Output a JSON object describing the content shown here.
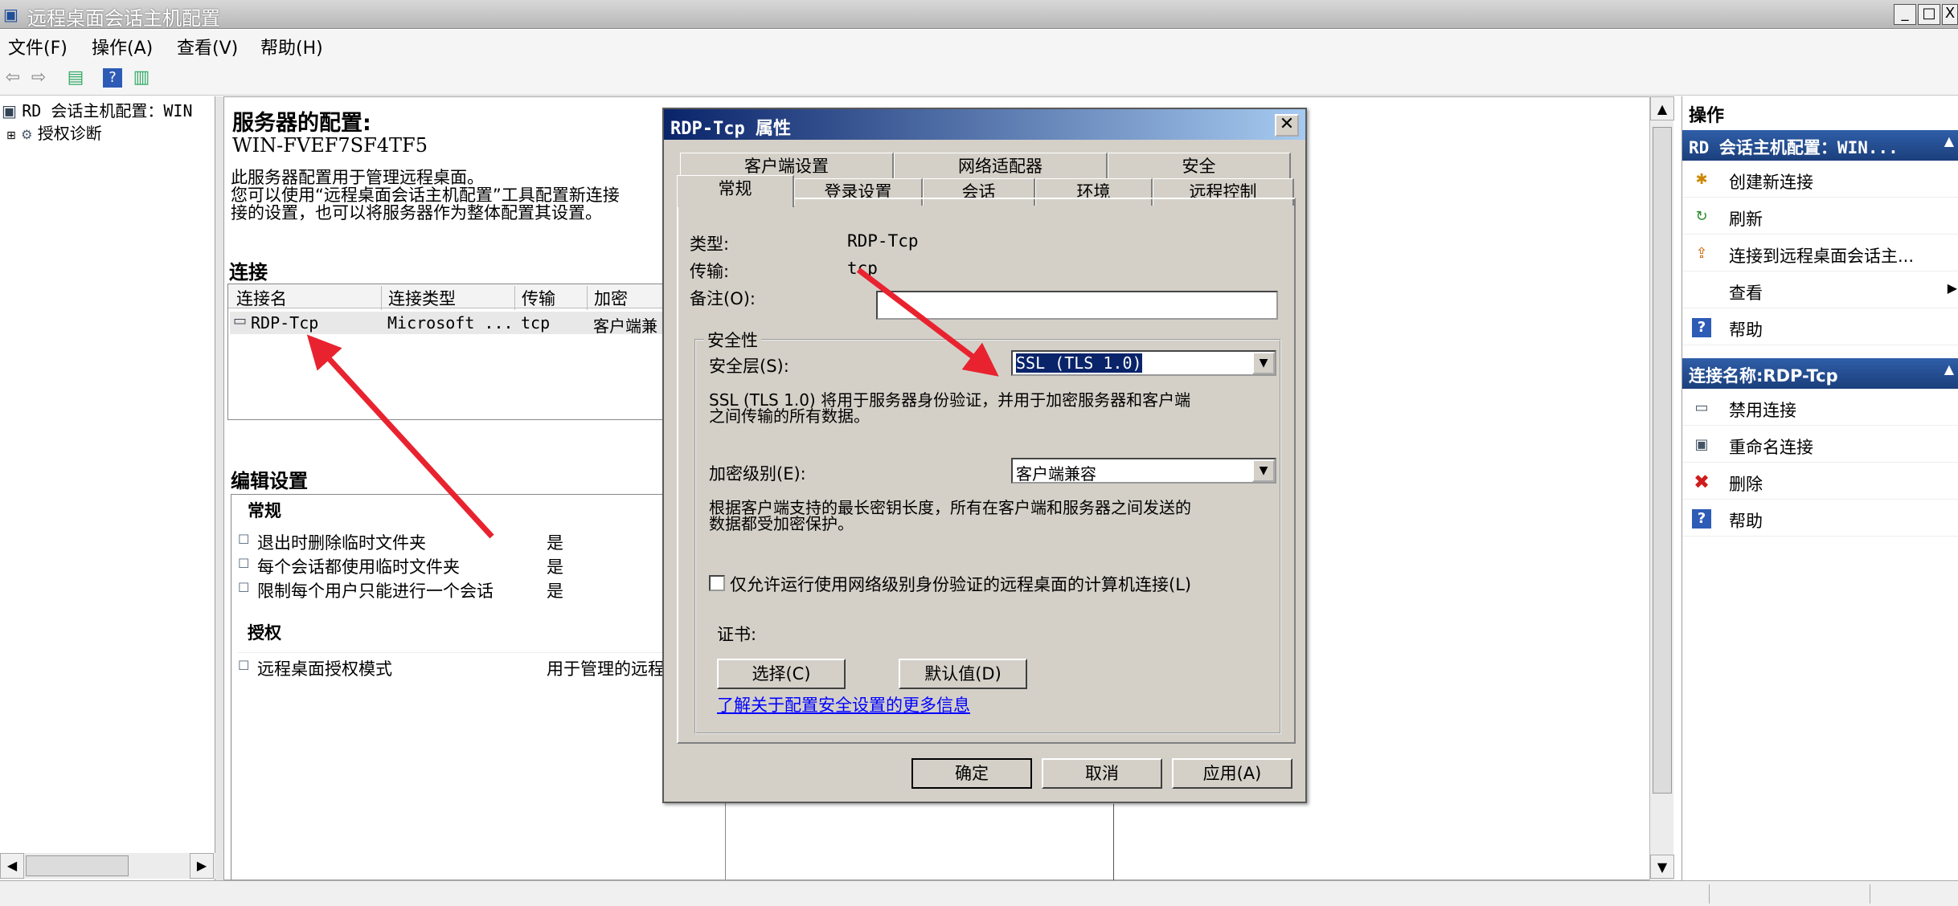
{
  "window": {
    "title": "远程桌面会话主机配置",
    "min": "_",
    "max": "□",
    "close": "X"
  },
  "menu": [
    "文件(F)",
    "操作(A)",
    "查看(V)",
    "帮助(H)"
  ],
  "tree": {
    "root": "RD 会话主机配置：WIN",
    "child": "授权诊断"
  },
  "center": {
    "heading": "服务器的配置:",
    "server": "WIN-FVEF7SF4TF5",
    "desc1": "此服务器配置用于管理远程桌面。",
    "desc2": "您可以使用“远程桌面会话主机配置”工具配置新连接",
    "desc3": "接的设置，也可以将服务器作为整体配置其设置。",
    "connections_title": "连接",
    "columns": [
      "连接名",
      "连接类型",
      "传输",
      "加密"
    ],
    "row": [
      "RDP-Tcp",
      "Microsoft ...",
      "tcp",
      "客户端兼"
    ],
    "edit_title": "编辑设置",
    "general": "常规",
    "settings": [
      {
        "name": "退出时删除临时文件夹",
        "value": "是"
      },
      {
        "name": "每个会话都使用临时文件夹",
        "value": "是"
      },
      {
        "name": "限制每个用户只能进行一个会话",
        "value": "是"
      }
    ],
    "licensing": "授权",
    "license_item": {
      "name": "远程桌面授权模式",
      "value": "用于管理的远程"
    }
  },
  "actions": {
    "header": "操作",
    "section1": "RD 会话主机配置：WIN...",
    "items1": [
      "创建新连接",
      "刷新",
      "连接到远程桌面会话主...",
      "查看",
      "帮助"
    ],
    "section2": "连接名称:RDP-Tcp",
    "items2": [
      "禁用连接",
      "重命名连接",
      "删除",
      "帮助"
    ]
  },
  "dialog": {
    "title": "RDP-Tcp 属性",
    "tabs_row1": [
      "客户端设置",
      "网络适配器",
      "安全"
    ],
    "tabs_row2": [
      "常规",
      "登录设置",
      "会话",
      "环境",
      "远程控制"
    ],
    "type_label": "类型:",
    "type_value": "RDP-Tcp",
    "transport_label": "传输:",
    "transport_value": "tcp",
    "comment_label": "备注(O):",
    "comment_value": "",
    "security_group": "安全性",
    "security_layer_label": "安全层(S):",
    "security_layer_value": "SSL (TLS 1.0)",
    "security_desc1": "SSL (TLS 1.0) 将用于服务器身份验证，并用于加密服务器和客户端",
    "security_desc2": "之间传输的所有数据。",
    "encryption_label": "加密级别(E):",
    "encryption_value": "客户端兼容",
    "encryption_desc1": "根据客户端支持的最长密钥长度，所有在客户端和服务器之间发送的",
    "encryption_desc2": "数据都受加密保护。",
    "nla_checkbox": "仅允许运行使用网络级别身份验证的远程桌面的计算机连接(L)",
    "nla_checked": false,
    "cert_label": "证书:",
    "select_btn": "选择(C)",
    "default_btn": "默认值(D)",
    "link": "了解关于配置安全设置的更多信息",
    "ok": "确定",
    "cancel": "取消",
    "apply": "应用(A)"
  },
  "colors": {
    "annotation_arrow": "#e8232f",
    "dialog_title": "#0a246a",
    "action_header": "#2f5ea8"
  }
}
